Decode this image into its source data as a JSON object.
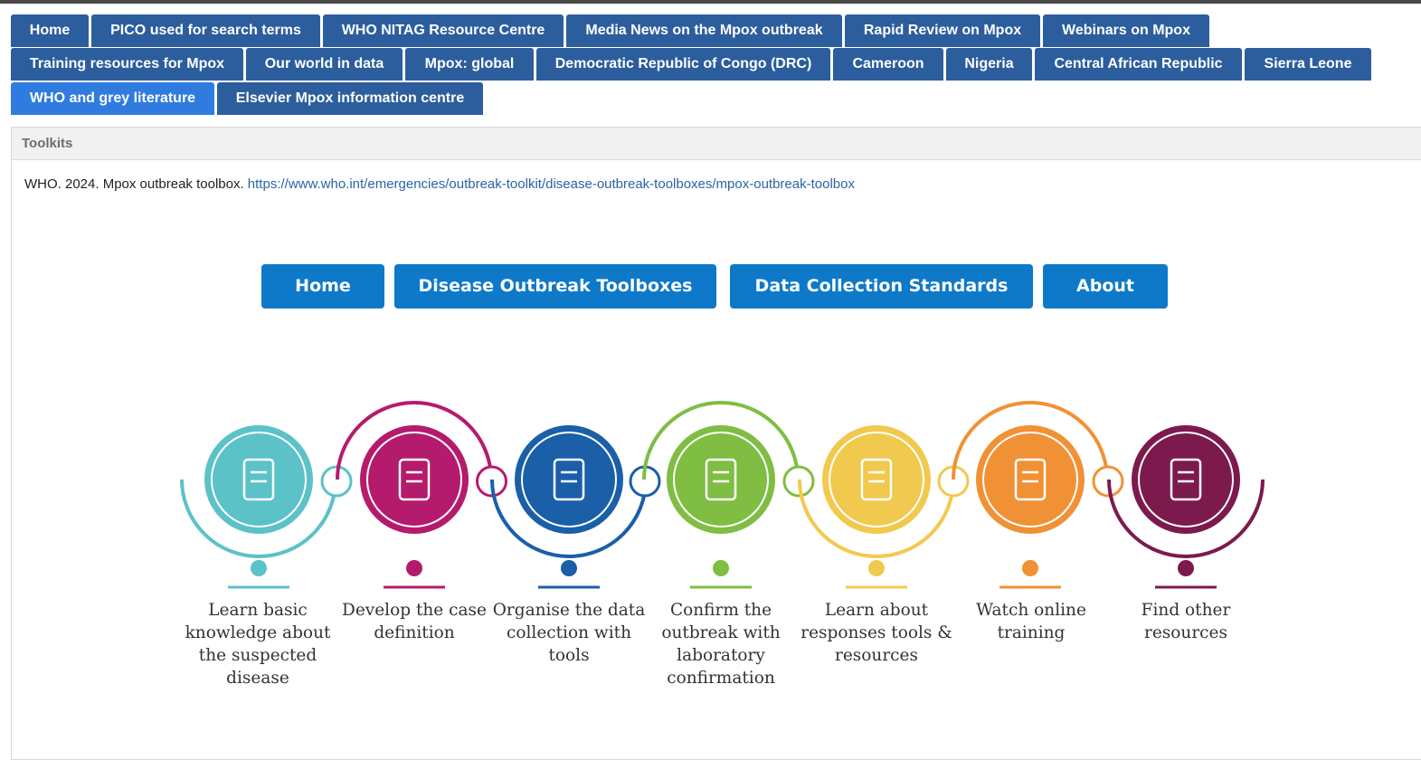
{
  "tabs": {
    "row1": [
      "Home",
      "PICO used for search terms",
      "WHO NITAG Resource Centre",
      "Media News on the Mpox outbreak",
      "Rapid Review on Mpox",
      "Webinars on Mpox"
    ],
    "row2": [
      "Training resources for Mpox",
      "Our world in data",
      "Mpox: global",
      "Democratic Republic of Congo (DRC)",
      "Cameroon",
      "Nigeria",
      "Central African Republic",
      "Sierra Leone"
    ],
    "row3": [
      "WHO and grey literature",
      "Elsevier Mpox information centre"
    ],
    "active": "WHO and grey literature"
  },
  "panel": {
    "header": "Toolkits",
    "citation_text": "WHO. 2024.  Mpox outbreak toolbox.",
    "citation_link": "https://www.who.int/emergencies/outbreak-toolkit/disease-outbreak-toolboxes/mpox-outbreak-toolbox"
  },
  "toolbox_nav": {
    "home": "Home",
    "disease_outbreak_toolboxes": "Disease Outbreak Toolboxes",
    "data_collection_standards": "Data Collection Standards",
    "about": "About"
  },
  "steps": [
    {
      "label": "Learn basic knowledge about the suspected disease",
      "color": "#5bc2c8",
      "icon": "teacher-icon"
    },
    {
      "label": "Develop the case definition",
      "color": "#b51b6c",
      "icon": "document-icon"
    },
    {
      "label": "Organise the data collection with tools",
      "color": "#1a5fa8",
      "icon": "phone-tools-icon"
    },
    {
      "label": "Confirm the outbreak with laboratory confirmation",
      "color": "#7fbd43",
      "icon": "microscope-icon"
    },
    {
      "label": "Learn about responses tools & resources",
      "color": "#f2c94f",
      "icon": "swiss-knife-icon"
    },
    {
      "label": "Watch online training",
      "color": "#f19135",
      "icon": "training-icon"
    },
    {
      "label": "Find other resources",
      "color": "#7c1a4d",
      "icon": "reading-icon"
    }
  ]
}
